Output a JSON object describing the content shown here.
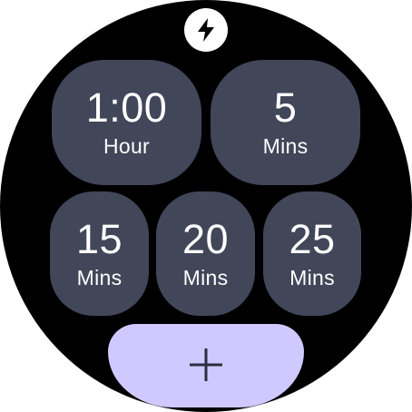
{
  "status": {
    "icon": "lightning-bolt-icon"
  },
  "presets": [
    {
      "value": "1:00",
      "unit": "Hour"
    },
    {
      "value": "5",
      "unit": "Mins"
    },
    {
      "value": "15",
      "unit": "Mins"
    },
    {
      "value": "20",
      "unit": "Mins"
    },
    {
      "value": "25",
      "unit": "Mins"
    }
  ],
  "add_button": {
    "icon": "plus-icon"
  },
  "colors": {
    "background": "#000000",
    "tile": "#424659",
    "tile_text": "#ffffff",
    "add_button": "#d0c9ff",
    "add_icon": "#2b2f3f"
  }
}
